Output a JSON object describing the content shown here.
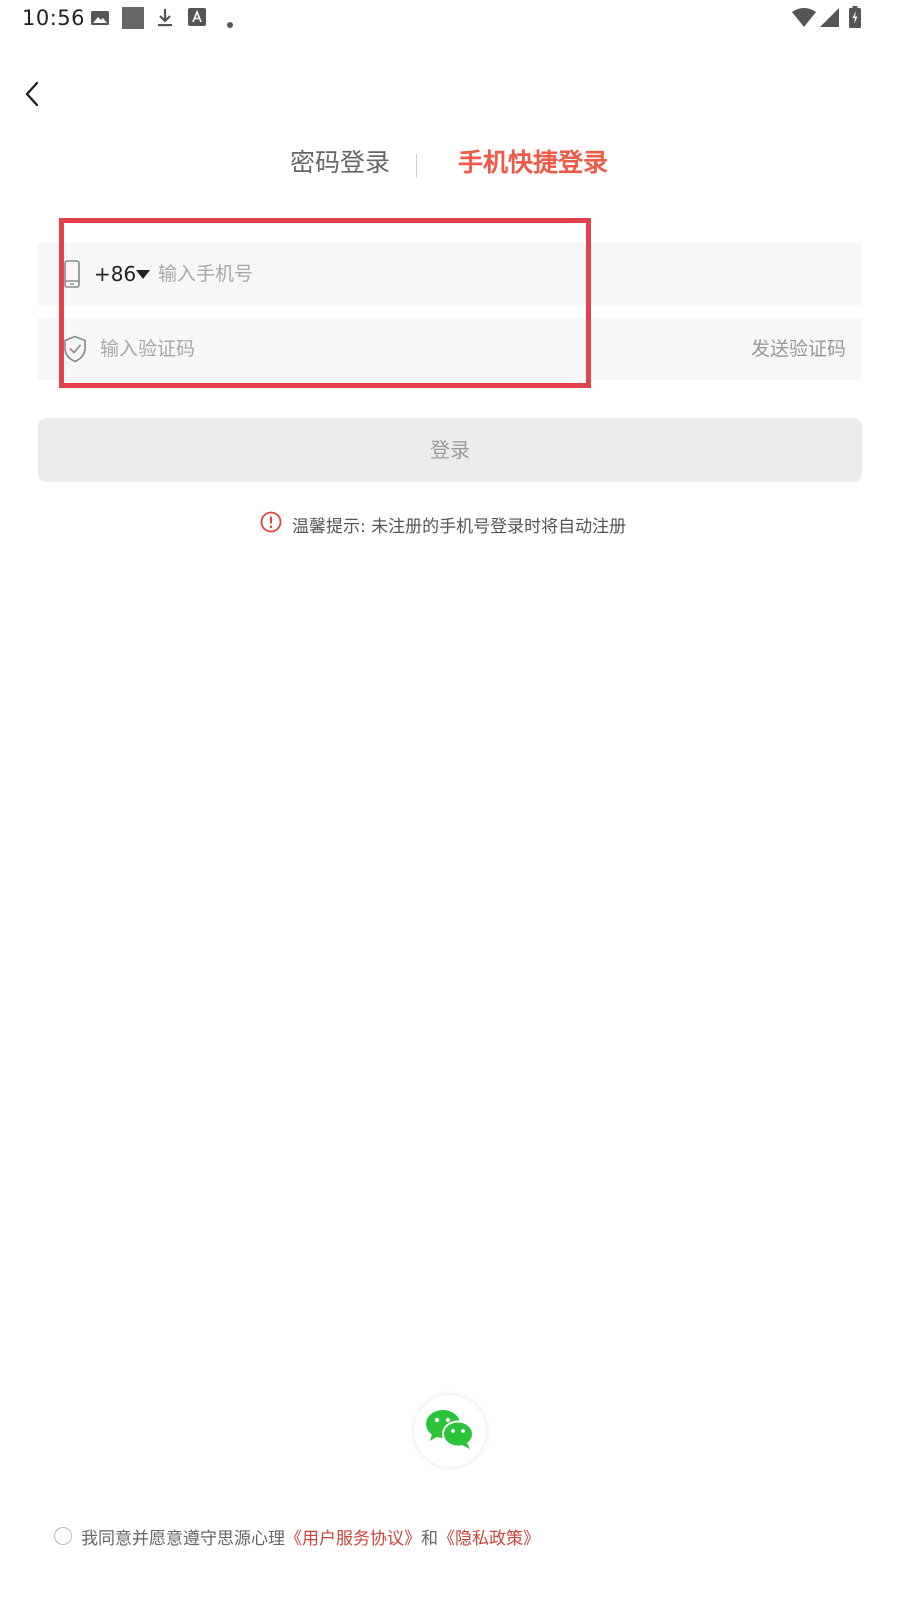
{
  "status_bar": {
    "time": "10:56",
    "left_icons": [
      "image-icon",
      "square-icon",
      "download-icon",
      "text-a-icon",
      "dot-icon"
    ],
    "right_icons": [
      "wifi-icon",
      "signal-icon",
      "battery-icon"
    ]
  },
  "nav": {
    "back_icon": "chevron-left-icon"
  },
  "tabs": {
    "password_login": "密码登录",
    "phone_login": "手机快捷登录",
    "active_color": "#ee5a45"
  },
  "form": {
    "country_code": "+86",
    "phone_placeholder": "输入手机号",
    "code_placeholder": "输入验证码",
    "send_code_label": "发送验证码",
    "login_label": "登录"
  },
  "tip": {
    "text": "温馨提示: 未注册的手机号登录时将自动注册",
    "icon": "alert-circle-icon",
    "icon_color": "#e0453f"
  },
  "social": {
    "wechat_icon": "wechat-icon",
    "wechat_color": "#2bc33a"
  },
  "agreement": {
    "prefix": "我同意并愿意遵守思源心理",
    "user_agreement": "《用户服务协议》",
    "conjunction": "和",
    "privacy_policy": "《隐私政策》",
    "link_color": "#c9453d"
  },
  "highlight_color": "#e2434a"
}
